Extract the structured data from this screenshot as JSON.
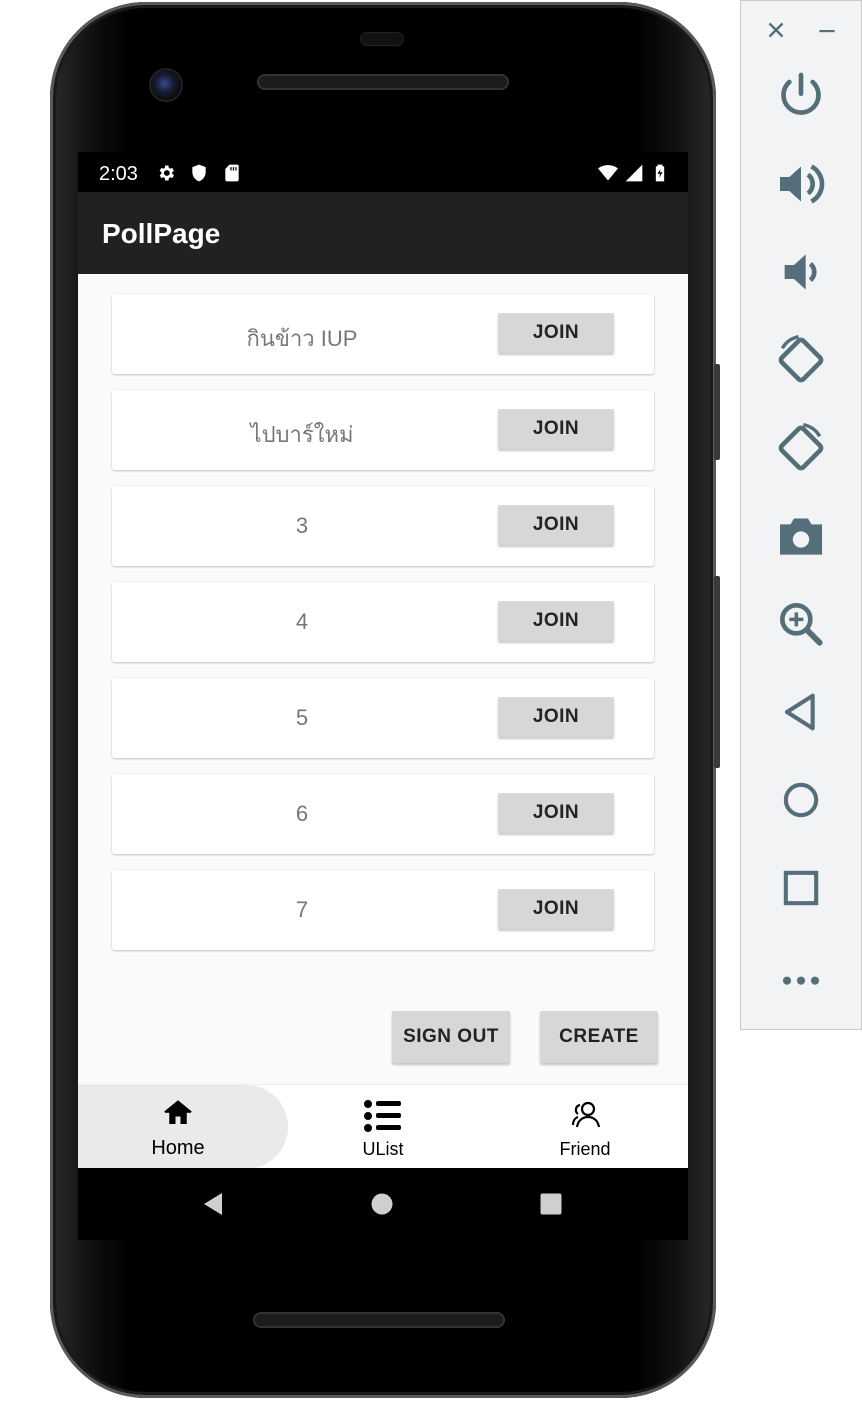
{
  "status_bar": {
    "time": "2:03"
  },
  "app_bar": {
    "title": "PollPage"
  },
  "polls": [
    {
      "name": "กินข้าว IUP",
      "button": "JOIN"
    },
    {
      "name": "ไปบาร์ใหม่",
      "button": "JOIN"
    },
    {
      "name": "3",
      "button": "JOIN"
    },
    {
      "name": "4",
      "button": "JOIN"
    },
    {
      "name": "5",
      "button": "JOIN"
    },
    {
      "name": "6",
      "button": "JOIN"
    },
    {
      "name": "7",
      "button": "JOIN"
    }
  ],
  "actions": {
    "sign_out": "SIGN OUT",
    "create": "CREATE"
  },
  "bottom_nav": {
    "items": [
      {
        "label": "Home",
        "icon": "home-icon",
        "active": true
      },
      {
        "label": "UList",
        "icon": "list-icon",
        "active": false
      },
      {
        "label": "Friend",
        "icon": "friends-icon",
        "active": false
      }
    ]
  },
  "emulator_panel": {
    "controls": [
      "close",
      "minimize",
      "power",
      "volume-up",
      "volume-down",
      "rotate-left",
      "rotate-right",
      "screenshot",
      "zoom",
      "back",
      "home",
      "overview",
      "more"
    ]
  },
  "colors": {
    "app_bar": "#212121",
    "button": "#d6d7d7",
    "panel_icon": "#546e7a"
  }
}
